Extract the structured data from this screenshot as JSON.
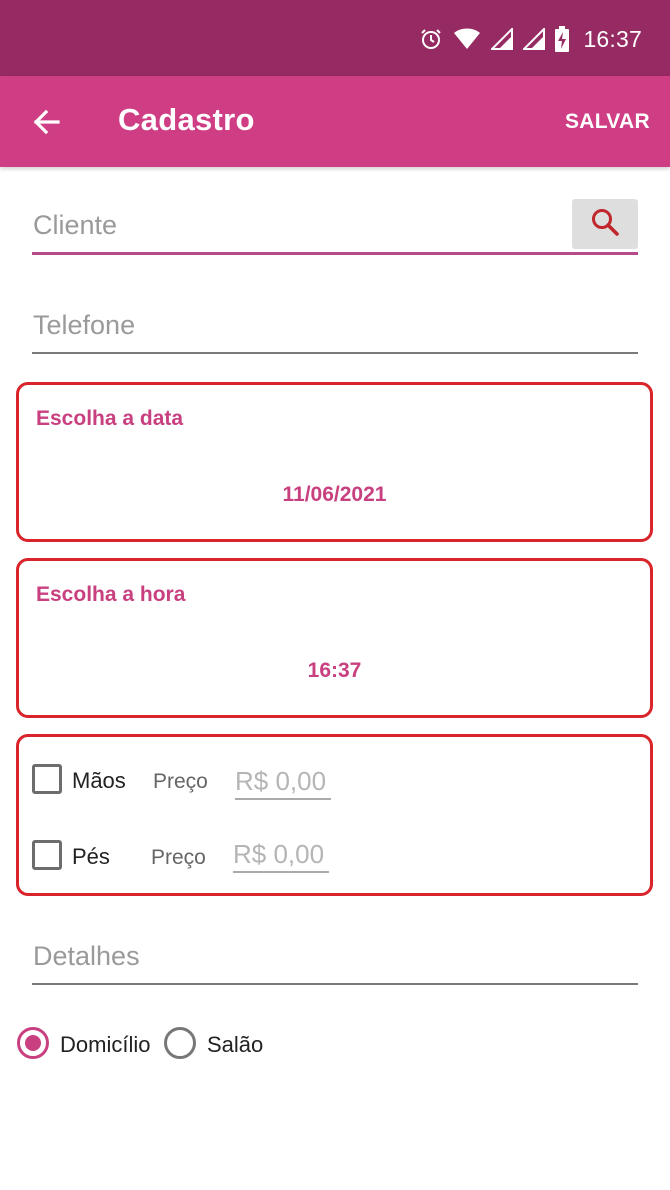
{
  "status_bar": {
    "time": "16:37",
    "icons": [
      "alarm-icon",
      "wifi-icon",
      "signal-icon",
      "signal-icon",
      "battery-charging-icon"
    ]
  },
  "app_bar": {
    "title": "Cadastro",
    "save_label": "SALVAR",
    "back_icon": "arrow-left-icon"
  },
  "form": {
    "cliente": {
      "placeholder": "Cliente",
      "value": ""
    },
    "search_icon": "search-icon",
    "telefone": {
      "placeholder": "Telefone",
      "value": ""
    },
    "date_card": {
      "label": "Escolha a data",
      "value": "11/06/2021"
    },
    "time_card": {
      "label": "Escolha a hora",
      "value": "16:37"
    },
    "services": [
      {
        "name": "Mãos",
        "checked": false,
        "price_label": "Preço",
        "price_placeholder": "R$ 0,00"
      },
      {
        "name": "Pés",
        "checked": false,
        "price_label": "Preço",
        "price_placeholder": "R$ 0,00"
      }
    ],
    "detalhes": {
      "placeholder": "Detalhes",
      "value": ""
    },
    "location_options": [
      {
        "label": "Domicílio",
        "checked": true
      },
      {
        "label": "Salão",
        "checked": false
      }
    ]
  },
  "colors": {
    "status_bar": "#962a63",
    "app_bar": "#cf3e85",
    "accent": "#c8407f",
    "card_border": "#d8242a",
    "search_icon": "#c0272d"
  }
}
